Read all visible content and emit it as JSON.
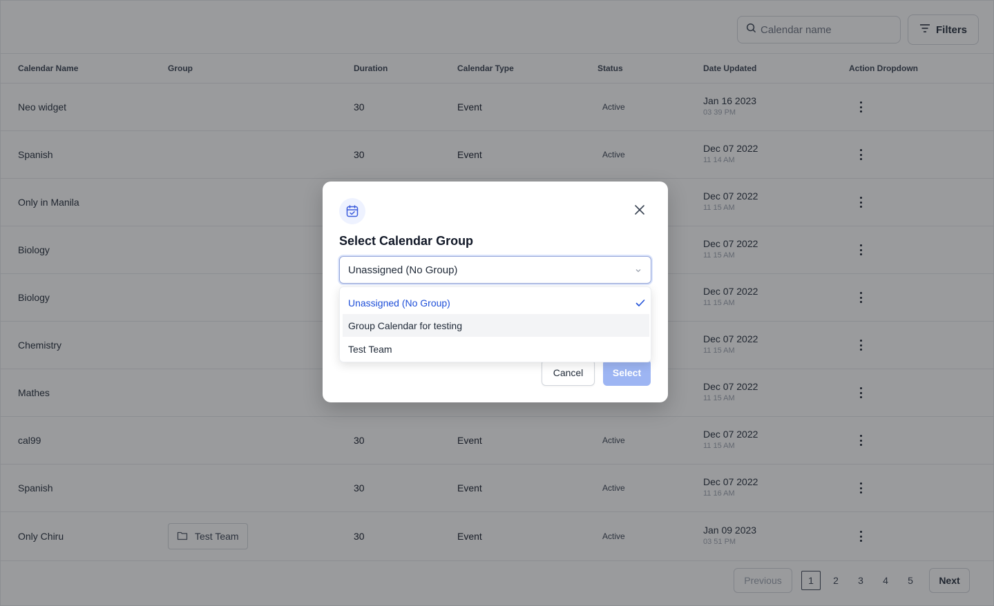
{
  "toolbar": {
    "search_placeholder": "Calendar name",
    "filters_label": "Filters"
  },
  "table": {
    "headers": {
      "name": "Calendar Name",
      "group": "Group",
      "duration": "Duration",
      "type": "Calendar Type",
      "status": "Status",
      "date": "Date Updated",
      "action": "Action Dropdown"
    },
    "rows": [
      {
        "name": "Neo widget",
        "group": "",
        "duration": "30",
        "type": "Event",
        "status": "Active",
        "date": "Jan 16 2023",
        "time": "03 39 PM"
      },
      {
        "name": "Spanish",
        "group": "",
        "duration": "30",
        "type": "Event",
        "status": "Active",
        "date": "Dec 07 2022",
        "time": "11 14 AM"
      },
      {
        "name": "Only in Manila",
        "group": "",
        "duration": "",
        "type": "",
        "status": "",
        "date": "Dec 07 2022",
        "time": "11 15 AM"
      },
      {
        "name": "Biology",
        "group": "",
        "duration": "",
        "type": "",
        "status": "",
        "date": "Dec 07 2022",
        "time": "11 15 AM"
      },
      {
        "name": "Biology",
        "group": "",
        "duration": "",
        "type": "",
        "status": "",
        "date": "Dec 07 2022",
        "time": "11 15 AM"
      },
      {
        "name": "Chemistry",
        "group": "",
        "duration": "",
        "type": "",
        "status": "",
        "date": "Dec 07 2022",
        "time": "11 15 AM"
      },
      {
        "name": "Mathes",
        "group": "",
        "duration": "",
        "type": "",
        "status": "",
        "date": "Dec 07 2022",
        "time": "11 15 AM"
      },
      {
        "name": "cal99",
        "group": "",
        "duration": "30",
        "type": "Event",
        "status": "Active",
        "date": "Dec 07 2022",
        "time": "11 15 AM"
      },
      {
        "name": "Spanish",
        "group": "",
        "duration": "30",
        "type": "Event",
        "status": "Active",
        "date": "Dec 07 2022",
        "time": "11 16 AM"
      },
      {
        "name": "Only Chiru",
        "group": "Test Team",
        "duration": "30",
        "type": "Event",
        "status": "Active",
        "date": "Jan 09 2023",
        "time": "03 51 PM"
      }
    ]
  },
  "pagination": {
    "previous": "Previous",
    "next": "Next",
    "pages": [
      "1",
      "2",
      "3",
      "4",
      "5"
    ],
    "current": "1"
  },
  "modal": {
    "title": "Select Calendar Group",
    "selected_value": "Unassigned (No Group)",
    "options": [
      "Unassigned (No Group)",
      "Group Calendar for testing",
      "Test Team"
    ],
    "cancel_label": "Cancel",
    "select_label": "Select",
    "accent_color": "#1d4ed8"
  }
}
